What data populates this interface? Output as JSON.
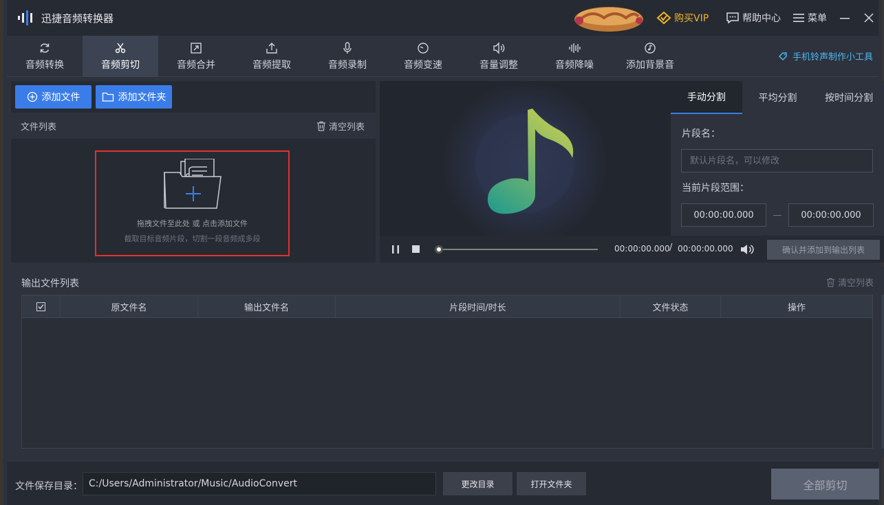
{
  "app": {
    "title": "迅捷音频转换器",
    "vip_label": "购买VIP",
    "help_label": "帮助中心",
    "menu_label": "菜单"
  },
  "toolbar": {
    "tools": [
      {
        "label": "音频转换",
        "icon": "refresh-icon"
      },
      {
        "label": "音频剪切",
        "icon": "scissors-icon",
        "active": true
      },
      {
        "label": "音频合并",
        "icon": "merge-icon"
      },
      {
        "label": "音频提取",
        "icon": "upload-icon"
      },
      {
        "label": "音频录制",
        "icon": "microphone-icon"
      },
      {
        "label": "音频变速",
        "icon": "speed-dial-icon"
      },
      {
        "label": "音量调整",
        "icon": "volume-icon"
      },
      {
        "label": "音频降噪",
        "icon": "waveform-icon"
      },
      {
        "label": "添加背景音",
        "icon": "music-disc-icon"
      }
    ],
    "ringtone_label": "手机铃声制作小工具"
  },
  "left": {
    "add_file_label": "添加文件",
    "add_folder_label": "添加文件夹",
    "file_list_label": "文件列表",
    "clear_list_label": "清空列表",
    "drop_hint_1": "拖拽文件至此处 或 点击添加文件",
    "drop_hint_2": "截取目标音频片段，切割一段音频成多段"
  },
  "player": {
    "current_time": "00:00:00.000",
    "separator": "/",
    "total_time": "00:00:00.000",
    "progress": 0,
    "confirm_label": "确认并添加到输出列表"
  },
  "split": {
    "tabs": [
      "手动分割",
      "平均分割",
      "按时间分割"
    ],
    "active_tab": 0,
    "segment_name_label": "片段名：",
    "segment_name_placeholder": "默认片段名，可以修改",
    "range_label": "当前片段范围：",
    "range_start": "00:00:00.000",
    "range_end": "00:00:00.000"
  },
  "output": {
    "title": "输出文件列表",
    "clear_label": "清空列表",
    "columns": [
      "原文件名",
      "输出文件名",
      "片段时间/时长",
      "文件状态",
      "操作"
    ],
    "rows": []
  },
  "footer": {
    "save_dir_label": "文件保存目录：",
    "save_path": "C:/Users/Administrator/Music/AudioConvert",
    "change_dir_label": "更改目录",
    "open_folder_label": "打开文件夹",
    "cut_all_label": "全部剪切"
  },
  "colors": {
    "accent": "#3b7de8",
    "vip": "#f0b429",
    "dropzone_border": "#e2322c",
    "ringtone_link": "#4fb6f2"
  }
}
